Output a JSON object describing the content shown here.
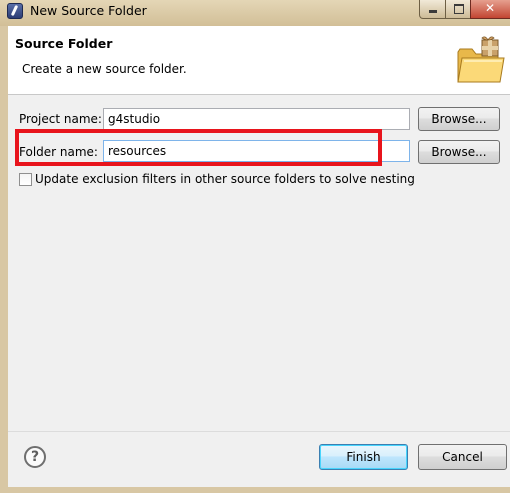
{
  "window": {
    "title": "New Source Folder"
  },
  "header": {
    "title": "Source Folder",
    "description": "Create a new source folder.",
    "icon": "folder-package-icon"
  },
  "form": {
    "project_label": "Project name:",
    "project_value": "g4studio",
    "folder_label": "Folder name:",
    "folder_value": "resources",
    "browse_label_1": "Browse...",
    "browse_label_2": "Browse...",
    "checkbox_label": "Update exclusion filters in other source folders to solve nesting",
    "checkbox_checked": false
  },
  "footer": {
    "help_icon": "help-icon",
    "finish_label": "Finish",
    "cancel_label": "Cancel"
  },
  "colors": {
    "highlight": "#e8141c",
    "default_button_border": "#3c7fb1"
  }
}
